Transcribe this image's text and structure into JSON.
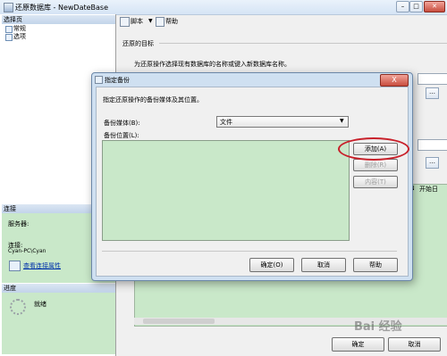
{
  "window": {
    "title": "还原数据库 - NewDateBase"
  },
  "left": {
    "select_page": "选择页",
    "pages": [
      "常规",
      "选项"
    ],
    "connection": {
      "header": "连接",
      "server_label": "服务器:",
      "conn_label": "连接:",
      "conn_value": "Cyan-PC\\Cyan",
      "view_props": "查看连接属性"
    },
    "progress": {
      "header": "进度",
      "status": "就绪"
    }
  },
  "toolbar": {
    "script": "脚本",
    "help": "帮助"
  },
  "main": {
    "section_title": "还原的目标",
    "instruction": "为还原操作选择现有数据库的名称或键入新数据库名称。",
    "grid_headers": [
      "SN",
      "开始日"
    ],
    "ok": "确定",
    "cancel": "取消"
  },
  "dialog": {
    "title": "指定备份",
    "close": "X",
    "instruction": "指定还原操作的备份媒体及其位置。",
    "media_label": "备份媒体(B):",
    "media_value": "文件",
    "location_label": "备份位置(L):",
    "add": "添加(A)",
    "remove": "删除(R)",
    "contents": "内容(T)",
    "ok": "确定(O)",
    "cancel": "取消",
    "help": "帮助"
  },
  "watermark": "Bai 经验",
  "colors": {
    "highlight_ring": "#c8202a",
    "list_bg": "#c9e8c9",
    "dialog_frame": "#cfe0f1"
  }
}
